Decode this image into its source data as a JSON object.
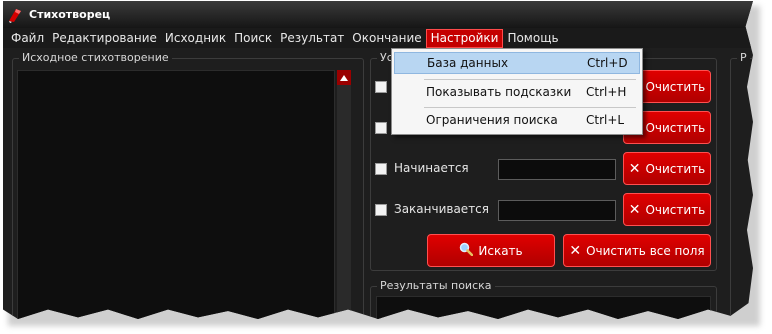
{
  "window": {
    "title": "Стихотворец",
    "accent": "#c40000"
  },
  "menu": {
    "items": [
      "Файл",
      "Редактирование",
      "Исходник",
      "Поиск",
      "Результат",
      "Окончание",
      "Настройки",
      "Помощь"
    ],
    "active_index": 6
  },
  "settings_menu": {
    "items": [
      {
        "label": "База данных",
        "shortcut": "Ctrl+D",
        "highlighted": true
      },
      {
        "label": "Показывать подсказки",
        "shortcut": "Ctrl+H",
        "highlighted": false
      },
      {
        "label": "Ограничения поиска",
        "shortcut": "Ctrl+L",
        "highlighted": false
      }
    ]
  },
  "source_group": {
    "title": "Исходное стихотворение"
  },
  "conditions": {
    "group_title_fragment": "Ус",
    "rows": [
      {
        "label": "",
        "checked": false,
        "value": "",
        "clear_label": "Очистить"
      },
      {
        "label": "",
        "checked": false,
        "value": "",
        "clear_label": "Очистить"
      },
      {
        "label": "Начинается",
        "checked": false,
        "value": "",
        "clear_label": "Очистить"
      },
      {
        "label": "Заканчивается",
        "checked": false,
        "value": "",
        "clear_label": "Очистить"
      }
    ],
    "search_label": "Искать",
    "clear_all_label": "Очистить все поля"
  },
  "results_group": {
    "title": "Результаты поиска"
  },
  "right_group": {
    "title_fragment": "Р"
  }
}
